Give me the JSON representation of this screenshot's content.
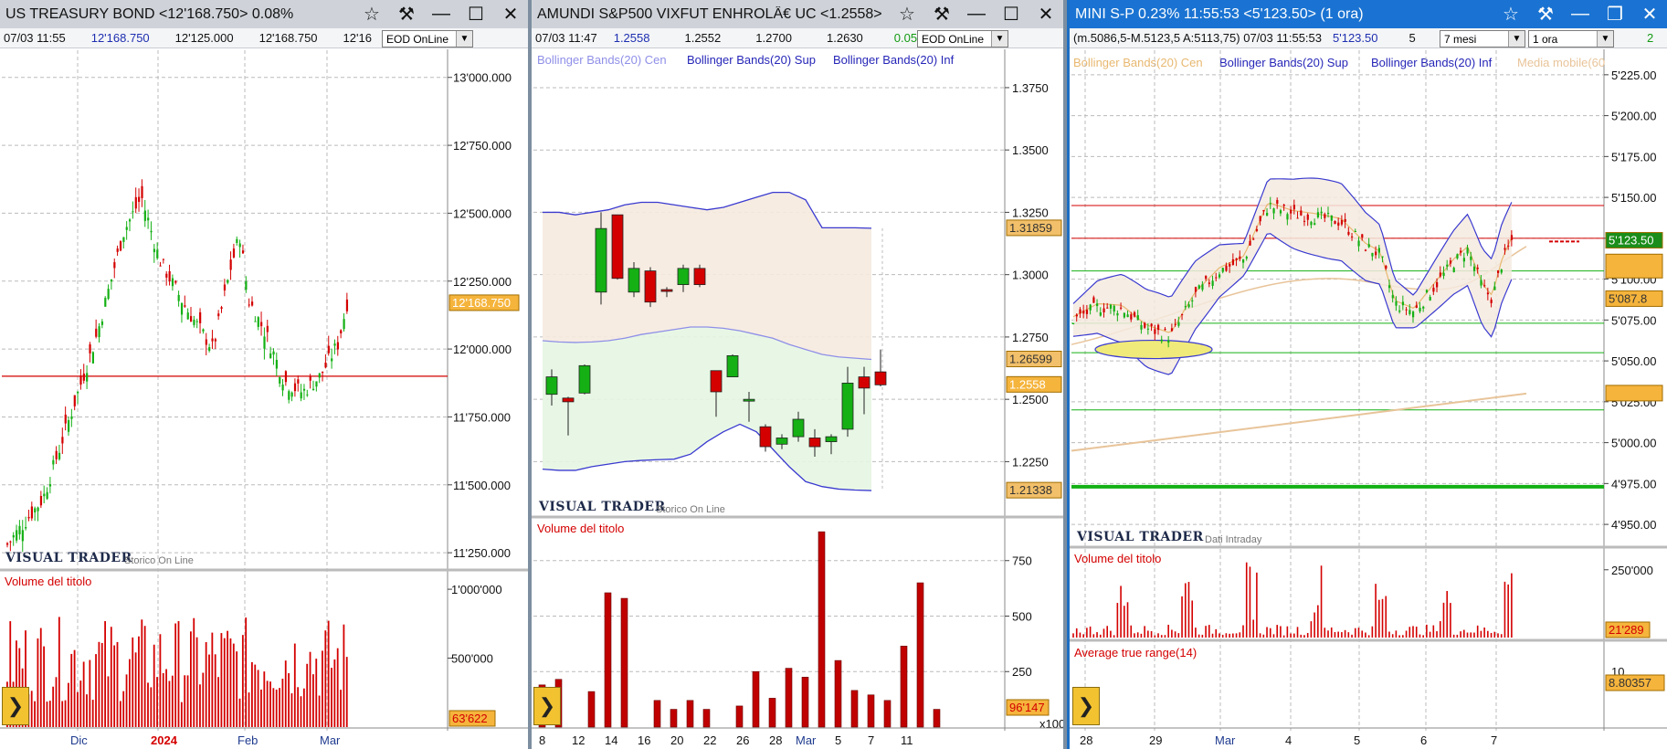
{
  "colors": {
    "up": "#14b014",
    "down": "#d40000",
    "bb_upper": "#3a3ad0",
    "bb_center": "#8f8fe8",
    "ma": "#e8c49a",
    "tag": "#f5b43c",
    "tag_blue_panel": "#1a73d2"
  },
  "panel1": {
    "title": "US TREASURY BOND <12'168.750> 0.08%",
    "info": [
      "07/03 11:55",
      "12'168.750",
      "12'125.000",
      "12'168.750",
      "12'16"
    ],
    "feed": "EOD OnLine",
    "y_ticks": [
      "13'000.000",
      "12'750.000",
      "12'500.000",
      "12'250.000",
      "12'000.000",
      "11'750.000",
      "11'500.000",
      "11'250.000"
    ],
    "price_tag": "12'168.750",
    "watermark": "VISUAL TRADER",
    "watermark_sub": "Storico On Line",
    "volume_label": "Volume del titolo",
    "vol_ticks": [
      "1'000'000",
      "500'000"
    ],
    "vol_tag": "63'622",
    "x_ticks": [
      "Dic",
      "2024",
      "Feb",
      "Mar"
    ]
  },
  "panel2": {
    "title": "AMUNDI S&P500 VIXFUT ENHROLÂ€ UC <1.2558>",
    "info": [
      "07/03 11:47",
      "1.2558",
      "1.2552",
      "1.2700",
      "1.2630",
      "0.05%"
    ],
    "feed": "EOD OnLine",
    "legend": [
      "Bollinger Bands(20) Cen",
      "Bollinger Bands(20) Sup",
      "Bollinger Bands(20) Inf"
    ],
    "y_ticks": [
      "1.3750",
      "1.3500",
      "1.3250",
      "1.3000",
      "1.2750",
      "1.2500",
      "1.2250"
    ],
    "tags": [
      "1.31859",
      "1.26599",
      "1.2558",
      "1.21338"
    ],
    "watermark": "VISUAL TRADER",
    "watermark_sub": "Storico On Line",
    "volume_label": "Volume del titolo",
    "vol_ticks": [
      "750",
      "500",
      "250"
    ],
    "vol_tag": "96'147",
    "vol_mult": "x1000",
    "x_ticks": [
      "8",
      "12",
      "14",
      "16",
      "20",
      "22",
      "26",
      "28",
      "Mar",
      "5",
      "7",
      "11"
    ]
  },
  "panel3": {
    "title": "MINI S-P 0.23% 11:55:53 <5'123.50> (1 ora)",
    "info": [
      "(m.5086,5-M.5123,5 A:5113,75) 07/03 11:55:53",
      "5'123.50",
      "5"
    ],
    "range_select": "7 mesi",
    "interval_select": "1 ora",
    "info_tail": "2",
    "legend": [
      "Bollinger Bands(20) Cen",
      "Bollinger Bands(20) Sup",
      "Bollinger Bands(20) Inf",
      "Media mobile(60"
    ],
    "y_ticks": [
      "5'225.00",
      "5'200.00",
      "5'175.00",
      "5'150.00",
      "5'125.00",
      "5'100.00",
      "5'075.00",
      "5'050.00",
      "5'025.00",
      "5'000.00",
      "4'975.00",
      "4'950.00"
    ],
    "price_tag": "5'123.50",
    "tag_low": "5'087.8",
    "watermark": "VISUAL TRADER",
    "watermark_sub": "Dati Intraday",
    "volume_label": "Volume del titolo",
    "vol_ticks": [
      "250'000"
    ],
    "vol_tag": "21'289",
    "atr_label": "Average true range(14)",
    "atr_tick": "10",
    "atr_tag": "8.80357",
    "x_ticks": [
      "28",
      "29",
      "Mar",
      "4",
      "5",
      "6",
      "7"
    ]
  },
  "chart_data": [
    {
      "type": "candlestick",
      "title": "US TREASURY BOND <12'168.750> 0.08%",
      "x_ticks": [
        "Dic",
        "2024",
        "Feb",
        "Mar"
      ],
      "ylim": [
        11200,
        13100
      ],
      "close_path": [
        [
          0,
          11280
        ],
        [
          0.08,
          11450
        ],
        [
          0.14,
          11750
        ],
        [
          0.2,
          12050
        ],
        [
          0.26,
          12430
        ],
        [
          0.3,
          12560
        ],
        [
          0.34,
          12330
        ],
        [
          0.4,
          12150
        ],
        [
          0.46,
          12000
        ],
        [
          0.5,
          12300
        ],
        [
          0.52,
          12420
        ],
        [
          0.54,
          12180
        ],
        [
          0.58,
          12050
        ],
        [
          0.62,
          11880
        ],
        [
          0.66,
          11840
        ],
        [
          0.7,
          11900
        ],
        [
          0.74,
          12020
        ],
        [
          0.76,
          12168.75
        ]
      ],
      "horizontal_line": 11900,
      "volume_ylim": [
        0,
        1100000
      ]
    },
    {
      "type": "candlestick",
      "title": "AMUNDI S&P500 VIXFUT ENHROLÂ€ UC <1.2558>",
      "ylim": [
        1.205,
        1.39
      ],
      "candles": [
        {
          "x": "8",
          "open": 1.252,
          "high": 1.262,
          "low": 1.2475,
          "close": 1.259
        },
        {
          "x": "9",
          "open": 1.2505,
          "high": 1.251,
          "low": 1.2355,
          "close": 1.249
        },
        {
          "x": "12",
          "open": 1.2525,
          "high": 1.264,
          "low": 1.252,
          "close": 1.2635
        },
        {
          "x": "13",
          "open": 1.293,
          "high": 1.325,
          "low": 1.288,
          "close": 1.3185
        },
        {
          "x": "14",
          "open": 1.324,
          "high": 1.324,
          "low": 1.298,
          "close": 1.2985
        },
        {
          "x": "15",
          "open": 1.293,
          "high": 1.305,
          "low": 1.291,
          "close": 1.3025
        },
        {
          "x": "16",
          "open": 1.3015,
          "high": 1.303,
          "low": 1.287,
          "close": 1.289
        },
        {
          "x": "19",
          "open": 1.294,
          "high": 1.295,
          "low": 1.291,
          "close": 1.2935
        },
        {
          "x": "20",
          "open": 1.296,
          "high": 1.304,
          "low": 1.293,
          "close": 1.3025
        },
        {
          "x": "21",
          "open": 1.3025,
          "high": 1.304,
          "low": 1.295,
          "close": 1.296
        },
        {
          "x": "22",
          "open": 1.2615,
          "high": 1.2615,
          "low": 1.243,
          "close": 1.253
        },
        {
          "x": "23",
          "open": 1.259,
          "high": 1.268,
          "low": 1.259,
          "close": 1.2675
        },
        {
          "x": "26",
          "open": 1.25,
          "high": 1.253,
          "low": 1.241,
          "close": 1.25
        },
        {
          "x": "27",
          "open": 1.239,
          "high": 1.24,
          "low": 1.229,
          "close": 1.231
        },
        {
          "x": "28",
          "open": 1.232,
          "high": 1.236,
          "low": 1.23,
          "close": 1.2345
        },
        {
          "x": "29",
          "open": 1.235,
          "high": 1.245,
          "low": 1.233,
          "close": 1.242
        },
        {
          "x": "Mar",
          "open": 1.2345,
          "high": 1.238,
          "low": 1.227,
          "close": 1.231
        },
        {
          "x": "4",
          "open": 1.233,
          "high": 1.236,
          "low": 1.228,
          "close": 1.235
        },
        {
          "x": "5",
          "open": 1.238,
          "high": 1.263,
          "low": 1.235,
          "close": 1.2565
        },
        {
          "x": "6",
          "open": 1.259,
          "high": 1.263,
          "low": 1.244,
          "close": 1.2545
        },
        {
          "x": "7",
          "open": 1.261,
          "high": 1.27,
          "low": 1.2552,
          "close": 1.2558
        }
      ],
      "bb_upper": [
        1.325,
        1.325,
        1.324,
        1.325,
        1.326,
        1.328,
        1.329,
        1.329,
        1.328,
        1.327,
        1.326,
        1.327,
        1.329,
        1.331,
        1.333,
        1.333,
        1.33,
        1.3188,
        1.3188,
        1.3188,
        1.3186
      ],
      "bb_center": [
        1.2735,
        1.273,
        1.2728,
        1.273,
        1.2735,
        1.2745,
        1.276,
        1.277,
        1.278,
        1.279,
        1.279,
        1.2785,
        1.2775,
        1.276,
        1.2745,
        1.272,
        1.27,
        1.268,
        1.267,
        1.2665,
        1.266
      ],
      "bb_lower": [
        1.222,
        1.2215,
        1.2215,
        1.223,
        1.224,
        1.225,
        1.2255,
        1.2258,
        1.226,
        1.228,
        1.233,
        1.237,
        1.24,
        1.237,
        1.23,
        1.223,
        1.217,
        1.215,
        1.214,
        1.2136,
        1.2134
      ],
      "volume_thousands": [
        190,
        215,
        0,
        160,
        605,
        580,
        0,
        120,
        80,
        120,
        80,
        0,
        95,
        250,
        130,
        265,
        225,
        880,
        300,
        165,
        145,
        120,
        365,
        650,
        80
      ],
      "volume_ylim": [
        0,
        930
      ]
    },
    {
      "type": "candlestick",
      "title": "MINI S-P 0.23% 11:55:53 <5'123.50> (1 ora)",
      "x_ticks": [
        "28",
        "29",
        "Mar",
        "4",
        "5",
        "6",
        "7"
      ],
      "ylim": [
        4940,
        5240
      ],
      "close_path": [
        [
          0,
          5075
        ],
        [
          0.05,
          5083
        ],
        [
          0.1,
          5082
        ],
        [
          0.15,
          5070
        ],
        [
          0.2,
          5065
        ],
        [
          0.25,
          5090
        ],
        [
          0.3,
          5105
        ],
        [
          0.35,
          5112
        ],
        [
          0.4,
          5145
        ],
        [
          0.45,
          5140
        ],
        [
          0.5,
          5138
        ],
        [
          0.55,
          5135
        ],
        [
          0.6,
          5120
        ],
        [
          0.63,
          5115
        ],
        [
          0.66,
          5085
        ],
        [
          0.7,
          5080
        ],
        [
          0.74,
          5095
        ],
        [
          0.78,
          5110
        ],
        [
          0.81,
          5118
        ],
        [
          0.84,
          5095
        ],
        [
          0.86,
          5088
        ],
        [
          0.88,
          5110
        ],
        [
          0.9,
          5123.5
        ]
      ],
      "horizontal_lines_red": [
        5145,
        5125
      ],
      "horizontal_lines_green": [
        5105,
        5073,
        5055,
        5020,
        4973
      ],
      "ma_ylevels": [
        5003,
        5094,
        5120
      ],
      "volume_ylim": [
        0,
        320000
      ],
      "atr_last": 8.80357
    }
  ]
}
